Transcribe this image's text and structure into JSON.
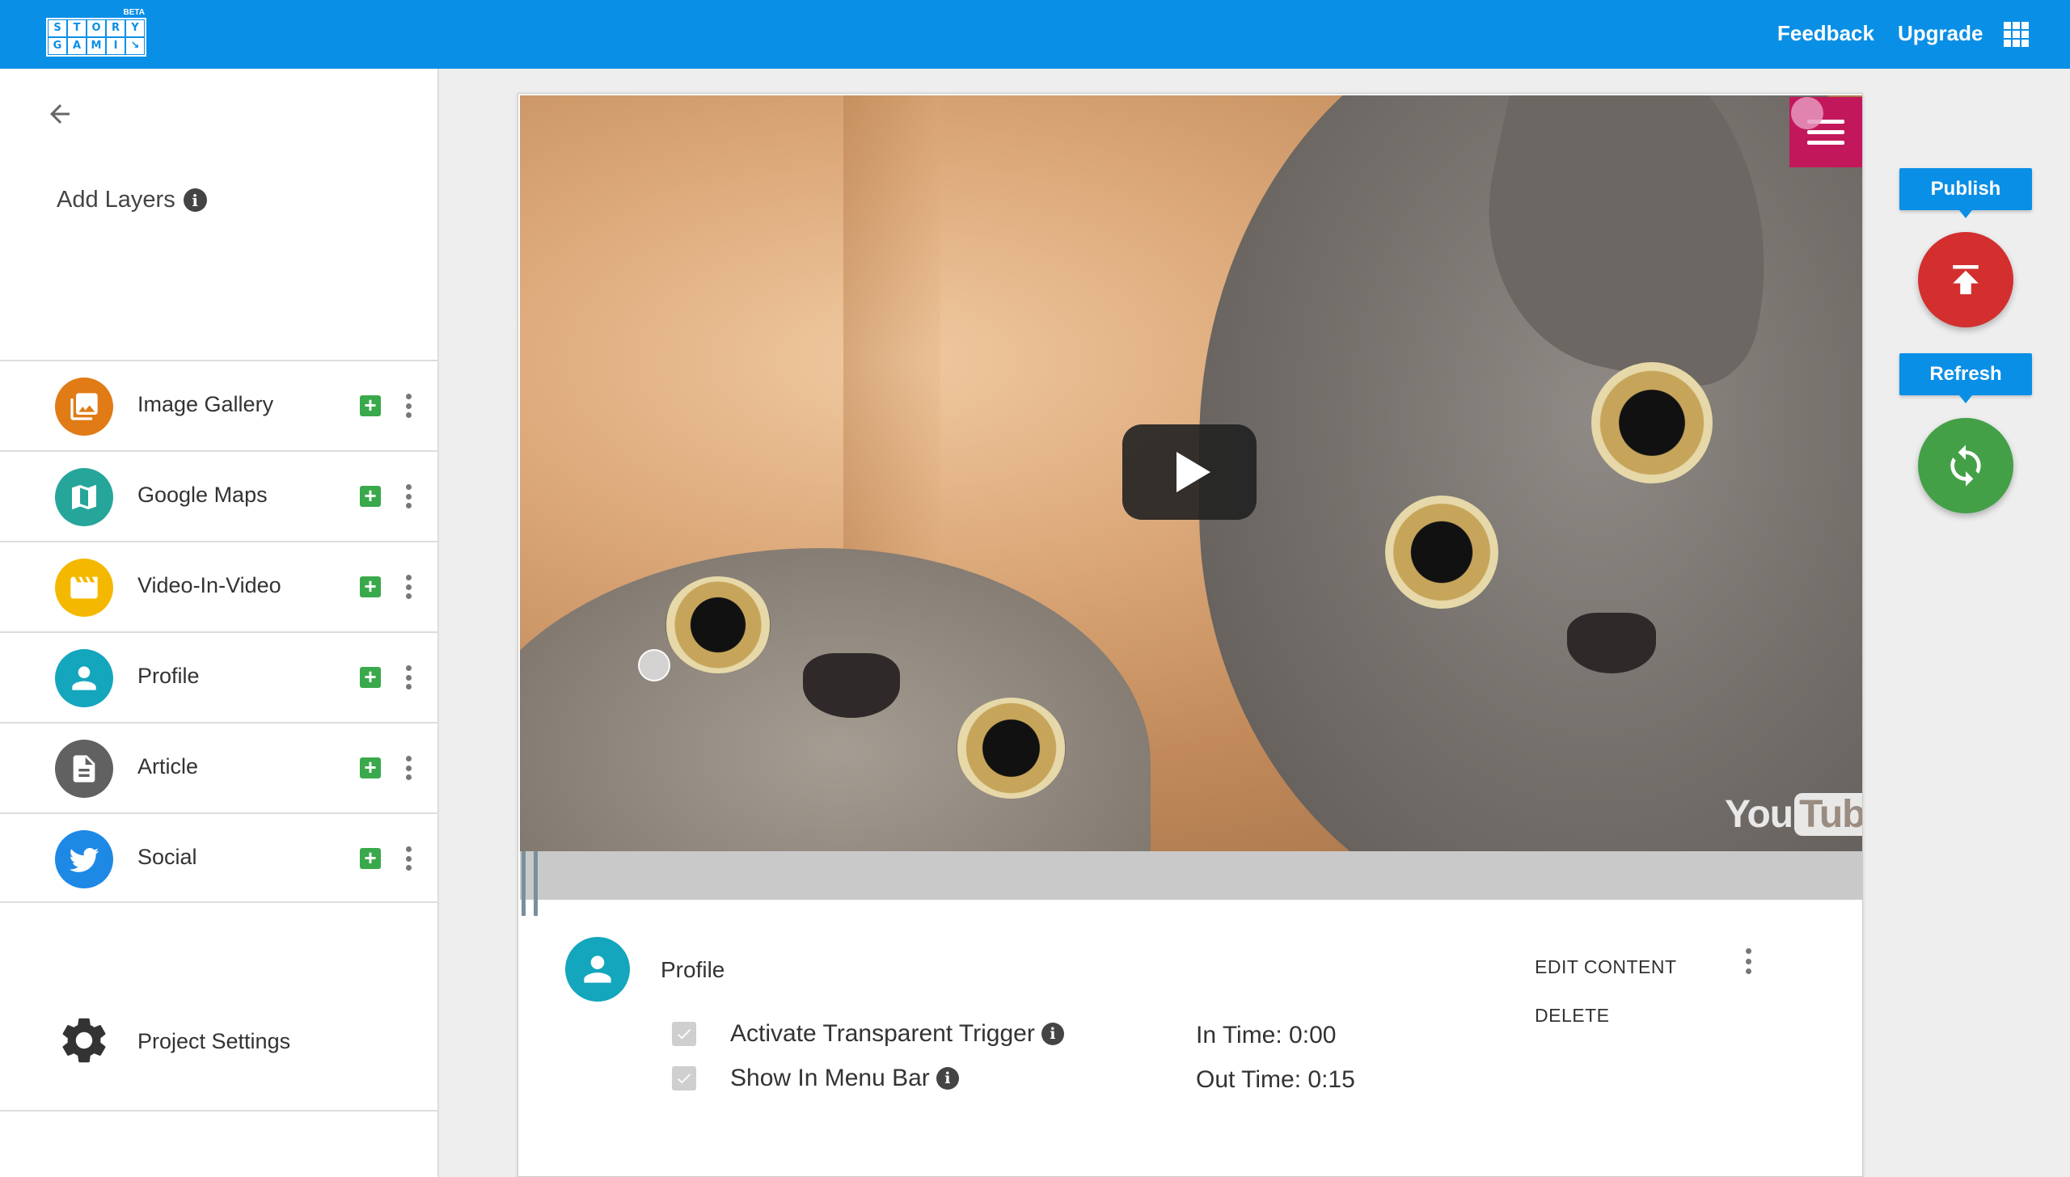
{
  "app": {
    "logo_letters": [
      "S",
      "T",
      "O",
      "R",
      "Y",
      "G",
      "A",
      "M",
      "I",
      "↘"
    ],
    "logo_beta": "BETA"
  },
  "topbar": {
    "feedback_label": "Feedback",
    "upgrade_label": "Upgrade",
    "apps_icon": "apps-grid-icon",
    "background_color": "#0a8fe6"
  },
  "sidebar": {
    "back_icon": "arrow-back-icon",
    "add_layers_title": "Add Layers",
    "info_glyph": "i",
    "layers": [
      {
        "label": "Image Gallery",
        "icon": "image-gallery-icon",
        "color": "#e07b16"
      },
      {
        "label": "Google Maps",
        "icon": "map-icon",
        "color": "#26a69a"
      },
      {
        "label": "Video-In-Video",
        "icon": "clapperboard-icon",
        "color": "#f5b800"
      },
      {
        "label": "Profile",
        "icon": "person-icon",
        "color": "#13a6bd"
      },
      {
        "label": "Article",
        "icon": "document-icon",
        "color": "#616161"
      },
      {
        "label": "Social",
        "icon": "twitter-bird-icon",
        "color": "#1e88e5"
      }
    ],
    "add_glyph": "+",
    "settings_label": "Project Settings"
  },
  "video": {
    "watermark_you": "You",
    "watermark_tube": "Tube"
  },
  "layer_panel": {
    "title": "Profile",
    "edit_content_label": "EDIT CONTENT",
    "delete_label": "DELETE",
    "options": [
      {
        "label": "Activate Transparent Trigger",
        "checked": true
      },
      {
        "label": "Show In Menu Bar",
        "checked": true
      }
    ],
    "in_time_label": "In Time:",
    "in_time_value": "0:00",
    "out_time_label": "Out Time:",
    "out_time_value": "0:15"
  },
  "actions": {
    "publish_label": "Publish",
    "publish_color": "#d32f2f",
    "refresh_label": "Refresh",
    "refresh_color": "#43a047"
  }
}
